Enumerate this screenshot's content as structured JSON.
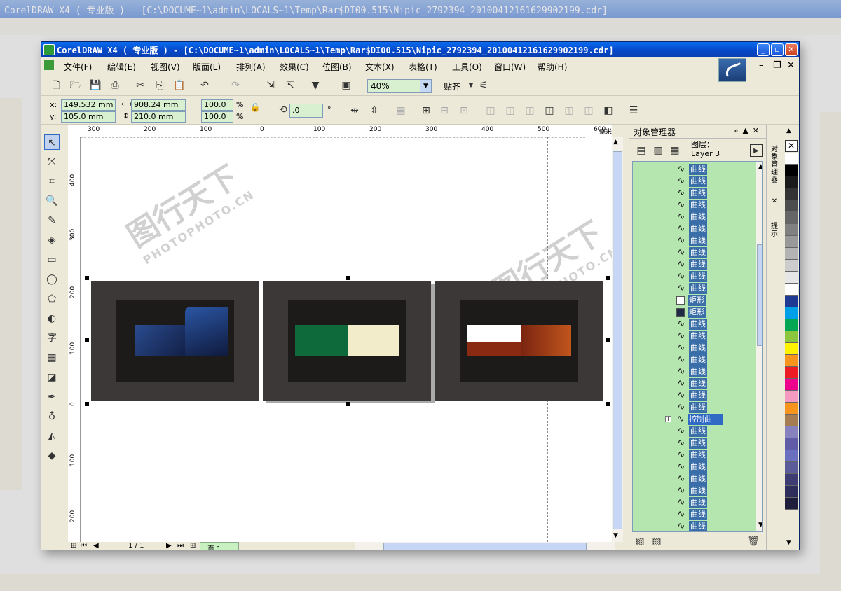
{
  "app": {
    "title": "CorelDRAW X4 ( 专业版 ) - [C:\\DOCUME~1\\admin\\LOCALS~1\\Temp\\Rar$DI00.515\\Nipic_2792394_20100412161629902199.cdr]",
    "background_title": "CorelDRAW X4 ( 专业版 ) - [C:\\DOCUME~1\\admin\\LOCALS~1\\Temp\\Rar$DI00.515\\Nipic_2792394_20100412161629902199.cdr]"
  },
  "menu": {
    "items": [
      "文件(F)",
      "编辑(E)",
      "视图(V)",
      "版面(L)",
      "排列(A)",
      "效果(C)",
      "位图(B)",
      "文本(X)",
      "表格(T)",
      "工具(O)",
      "窗口(W)",
      "帮助(H)"
    ]
  },
  "toolbar": {
    "zoom": "40%",
    "snap_label": "贴齐"
  },
  "properties": {
    "x_label": "x:",
    "y_label": "y:",
    "x_value": "149.532 mm",
    "y_value": "105.0 mm",
    "width_value": "908.24 mm",
    "height_value": "210.0 mm",
    "scale_x": "100.0",
    "scale_y": "100.0",
    "percent": "%",
    "rotation": ".0",
    "degree": "°"
  },
  "rulers": {
    "unit": "毫米",
    "horizontal": [
      "300",
      "200",
      "100",
      "0",
      "100",
      "200",
      "300",
      "400",
      "500",
      "600"
    ],
    "vertical": [
      "400",
      "300",
      "200",
      "100",
      "0",
      "100",
      "200"
    ]
  },
  "status": {
    "page_count": "1 / 1",
    "page_tab": "页 1"
  },
  "watermark": {
    "title": "图行天下",
    "sub": "PHOTOPHOTO.CN"
  },
  "docker": {
    "title": "对象管理器",
    "layer_label": "图层：",
    "layer_name": "Layer 3",
    "items": [
      {
        "kind": "curve",
        "name": "曲线"
      },
      {
        "kind": "curve",
        "name": "曲线"
      },
      {
        "kind": "curve",
        "name": "曲线"
      },
      {
        "kind": "curve",
        "name": "曲线"
      },
      {
        "kind": "curve",
        "name": "曲线"
      },
      {
        "kind": "curve",
        "name": "曲线"
      },
      {
        "kind": "curve",
        "name": "曲线"
      },
      {
        "kind": "curve",
        "name": "曲线"
      },
      {
        "kind": "curve",
        "name": "曲线"
      },
      {
        "kind": "curve",
        "name": "曲线"
      },
      {
        "kind": "curve",
        "name": "曲线"
      },
      {
        "kind": "rect-white",
        "name": "矩形"
      },
      {
        "kind": "rect-dark",
        "name": "矩形"
      },
      {
        "kind": "curve",
        "name": "曲线"
      },
      {
        "kind": "curve",
        "name": "曲线"
      },
      {
        "kind": "curve",
        "name": "曲线"
      },
      {
        "kind": "curve",
        "name": "曲线"
      },
      {
        "kind": "curve",
        "name": "曲线"
      },
      {
        "kind": "curve",
        "name": "曲线"
      },
      {
        "kind": "curve",
        "name": "曲线"
      },
      {
        "kind": "curve",
        "name": "曲线"
      },
      {
        "kind": "group",
        "name": "控制曲线"
      },
      {
        "kind": "curve",
        "name": "曲线"
      },
      {
        "kind": "curve",
        "name": "曲线"
      },
      {
        "kind": "curve",
        "name": "曲线"
      },
      {
        "kind": "curve",
        "name": "曲线"
      },
      {
        "kind": "curve",
        "name": "曲线"
      },
      {
        "kind": "curve",
        "name": "曲线"
      },
      {
        "kind": "curve",
        "name": "曲线"
      },
      {
        "kind": "curve",
        "name": "曲线"
      },
      {
        "kind": "curve",
        "name": "曲线"
      },
      {
        "kind": "curve",
        "name": "曲线"
      }
    ]
  },
  "side_tabs": {
    "tab1": "对象管理器",
    "tab2": "提示"
  },
  "palette": [
    "#ffffff",
    "#000000",
    "#1a1a1a",
    "#333333",
    "#4d4d4d",
    "#666666",
    "#808080",
    "#999999",
    "#b3b3b3",
    "#cccccc",
    "#e6e6e6",
    "#ffffff",
    "#1f3a93",
    "#00a0e9",
    "#00a651",
    "#8cc63f",
    "#fff200",
    "#f7941d",
    "#ed1c24",
    "#ec008c",
    "#f49ac1",
    "#f7941d",
    "#a67c52",
    "#8781bd",
    "#605ca8",
    "#6a6fbf",
    "#5b5b9a",
    "#3d3d73",
    "#2e2e5c",
    "#1f1f3d"
  ]
}
